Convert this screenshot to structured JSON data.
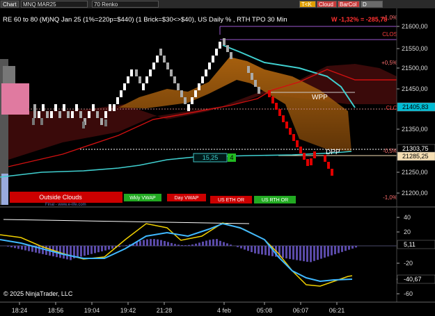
{
  "toolbar": {
    "left_label": "Chart",
    "instrument": "MNQ MAR25",
    "bar_type": "70 Renko",
    "toggle_buttons": [
      {
        "label": "T<K",
        "color": "#e0a000"
      },
      {
        "label": "Cloud",
        "color": "#c83a3a"
      },
      {
        "label": "BarCol",
        "color": "#c83a3a"
      },
      {
        "label": "D VWAP",
        "color": "#6a6a6a"
      }
    ]
  },
  "header": {
    "title": "RE 60 to 80 (M)NQ Jan 25 (1%=220p=$440) (1 Brick=$30<>$40), US Daily % , RTH TPO 30 Min",
    "change_text": "W -1,32% = -285,78",
    "change_color": "#ff3030"
  },
  "price_axis": {
    "ticks": [
      "21600,00",
      "21550,00",
      "21500,00",
      "21450,00",
      "21350,00",
      "21250,00",
      "21200,00"
    ],
    "badges": [
      {
        "label": "21405,83",
        "bg": "#00bcd4",
        "fg": "#000000"
      },
      {
        "label": "21303,75",
        "bg": "#000000",
        "fg": "#ffffff"
      },
      {
        "label": "21285,25",
        "bg": "#f5deb3",
        "fg": "#000000"
      }
    ]
  },
  "level_labels": {
    "top_pct": "+1,0%",
    "mid_pct": "+0,5%",
    "zero_pct": "-0,5%",
    "low_pct": "-1,0%",
    "clos_upper": "CLOS",
    "clos_lower": "CLO",
    "wpp": "WPP",
    "dpp": "DPP",
    "value_box": "15,25",
    "value_box_right": "4"
  },
  "legend_buttons": [
    {
      "label": "Outside Clouds",
      "bg": "#cc0000"
    },
    {
      "label": "Wkly VWAP",
      "bg": "#22aa22"
    },
    {
      "label": "Day VWAP",
      "bg": "#cc0000"
    },
    {
      "label": "US ETH OR",
      "bg": "#cc0000"
    },
    {
      "label": "US RTH OR",
      "bg": "#22aa22"
    }
  ],
  "watermark": "Final - www.e-life.com",
  "oscillator": {
    "ticks": [
      "40",
      "20",
      "-20",
      "-40",
      "-60"
    ],
    "badges": [
      {
        "label": "5,11",
        "bg": "#000000",
        "fg": "#ffffff"
      },
      {
        "label": "-40,67",
        "bg": "#000000",
        "fg": "#ffffff"
      }
    ]
  },
  "copyright": "© 2025 NinjaTrader, LLC",
  "time_axis": [
    "18:24",
    "18:56",
    "19:04",
    "19:42",
    "21:28",
    "4 feb",
    "05:08",
    "06:07",
    "06:21"
  ]
}
